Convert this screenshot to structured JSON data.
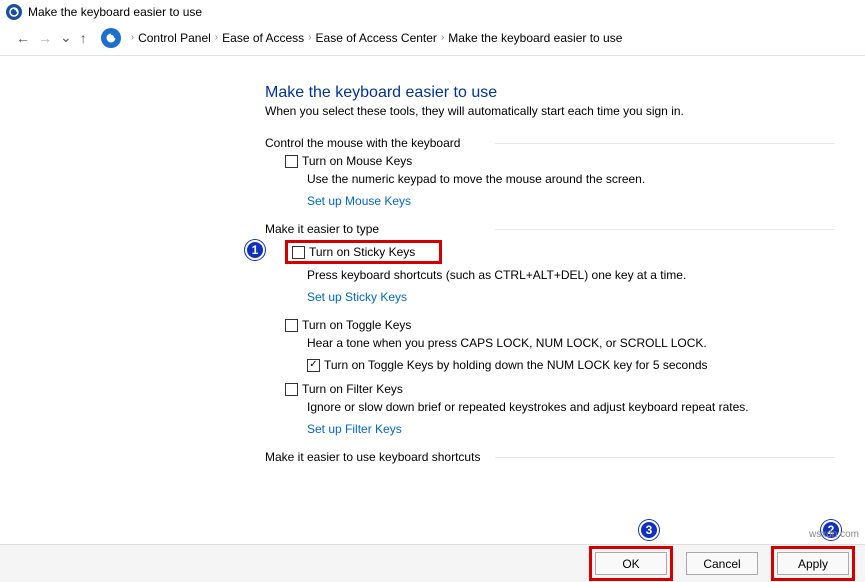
{
  "window": {
    "title": "Make the keyboard easier to use"
  },
  "breadcrumb": {
    "items": [
      "Control Panel",
      "Ease of Access",
      "Ease of Access Center",
      "Make the keyboard easier to use"
    ]
  },
  "page": {
    "heading": "Make the keyboard easier to use",
    "subtitle": "When you select these tools, they will automatically start each time you sign in."
  },
  "sections": {
    "mouse": {
      "label": "Control the mouse with the keyboard",
      "mouseKeys": {
        "label": "Turn on Mouse Keys",
        "desc": "Use the numeric keypad to move the mouse around the screen.",
        "link": "Set up Mouse Keys"
      }
    },
    "type": {
      "label": "Make it easier to type",
      "sticky": {
        "label": "Turn on Sticky Keys",
        "desc": "Press keyboard shortcuts (such as CTRL+ALT+DEL) one key at a time.",
        "link": "Set up Sticky Keys"
      },
      "toggle": {
        "label": "Turn on Toggle Keys",
        "desc": "Hear a tone when you press CAPS LOCK, NUM LOCK, or SCROLL LOCK.",
        "sub": "Turn on Toggle Keys by holding down the NUM LOCK key for 5 seconds"
      },
      "filter": {
        "label": "Turn on Filter Keys",
        "desc": "Ignore or slow down brief or repeated keystrokes and adjust keyboard repeat rates.",
        "link": "Set up Filter Keys"
      }
    },
    "shortcuts": {
      "label": "Make it easier to use keyboard shortcuts"
    }
  },
  "callouts": {
    "one": "1",
    "two": "2",
    "three": "3"
  },
  "footer": {
    "ok": "OK",
    "cancel": "Cancel",
    "apply": "Apply"
  },
  "watermark": "wsxdn.com"
}
